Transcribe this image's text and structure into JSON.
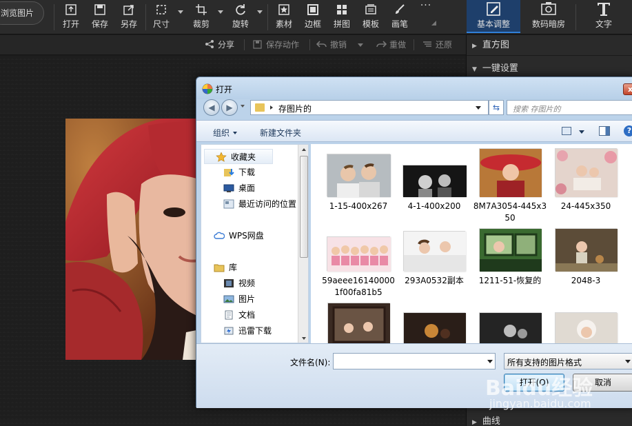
{
  "toolbar": {
    "browse_label": "浏览图片",
    "tools": [
      {
        "label": "打开",
        "icon": "open-icon"
      },
      {
        "label": "保存",
        "icon": "save-icon"
      },
      {
        "label": "另存",
        "icon": "save-as-icon"
      },
      {
        "label": "尺寸",
        "icon": "resize-icon"
      },
      {
        "label": "裁剪",
        "icon": "crop-icon"
      },
      {
        "label": "旋转",
        "icon": "rotate-icon"
      },
      {
        "label": "素材",
        "icon": "star-icon"
      },
      {
        "label": "边框",
        "icon": "frame-icon"
      },
      {
        "label": "拼图",
        "icon": "grid-icon"
      },
      {
        "label": "模板",
        "icon": "template-icon"
      },
      {
        "label": "画笔",
        "icon": "brush-icon"
      }
    ],
    "more_label": "···",
    "tabs": [
      {
        "label": "基本调整",
        "icon": "edit-icon"
      },
      {
        "label": "数码暗房",
        "icon": "camera-icon"
      },
      {
        "label": "文字",
        "icon": "text-icon"
      }
    ]
  },
  "subbar": {
    "share": "分享",
    "save_action": "保存动作",
    "undo": "撤销",
    "redo": "重做",
    "restore": "还原"
  },
  "right_panel": {
    "sections": [
      "直方图",
      "一键设置",
      "曲线"
    ]
  },
  "dialog": {
    "title": "打开",
    "close_glyph": "x",
    "breadcrumb": "存图片的",
    "search_placeholder": "搜索 存图片的",
    "organize": "组织",
    "new_folder": "新建文件夹",
    "help_glyph": "?",
    "nav": {
      "favorites": "收藏夹",
      "items_fav": [
        "下载",
        "桌面",
        "最近访问的位置"
      ],
      "wps": "WPS网盘",
      "library": "库",
      "items_lib": [
        "视频",
        "图片",
        "文档",
        "迅雷下载"
      ]
    },
    "files": [
      {
        "name": "1-15-400x267"
      },
      {
        "name": "4-1-400x200"
      },
      {
        "name": "8M7A3054-445x350"
      },
      {
        "name": "24-445x350"
      },
      {
        "name": "59aeee161400001f00fa81b5"
      },
      {
        "name": "293A0532副本"
      },
      {
        "name": "1211-51-恢复的"
      },
      {
        "name": "2048-3"
      }
    ],
    "filename_label": "文件名(N):",
    "filename_value": "",
    "filetype": "所有支持的图片格式",
    "open_button": "打开(O)",
    "cancel_button": "取消"
  },
  "watermark": {
    "logo": "Baidu经验",
    "url": "jingyan.baidu.com"
  }
}
